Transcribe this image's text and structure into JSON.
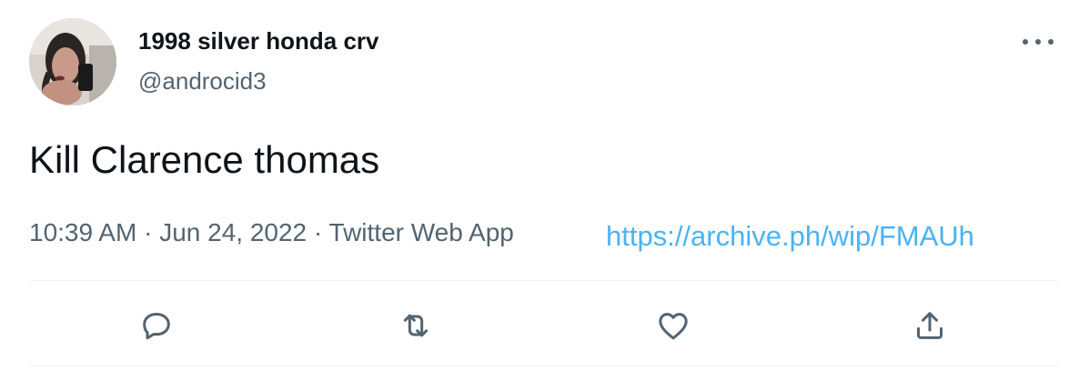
{
  "user": {
    "display_name": "1998 silver honda crv",
    "handle": "@androcid3",
    "avatar_icon": "profile-photo"
  },
  "tweet": {
    "text": "Kill Clarence thomas",
    "time": "10:39 AM",
    "separator": " · ",
    "date": "Jun 24, 2022",
    "source": "Twitter Web App"
  },
  "archive_link": "https://archive.ph/wip/FMAUh",
  "actions": [
    {
      "icon": "reply-icon"
    },
    {
      "icon": "retweet-icon"
    },
    {
      "icon": "like-icon"
    },
    {
      "icon": "share-icon"
    }
  ],
  "colors": {
    "text": "#0f1419",
    "secondary": "#536471",
    "link": "#4ab3f4",
    "divider": "#eff3f4"
  }
}
